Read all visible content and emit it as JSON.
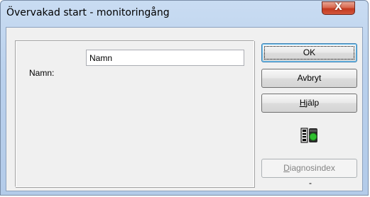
{
  "window": {
    "title": "Övervakad start - monitoringång",
    "close_label": "X"
  },
  "form": {
    "name_label": "Namn:",
    "name_value": "Namn"
  },
  "buttons": {
    "ok_label": "OK",
    "cancel_label": "Avbryt",
    "help_prefix": "H",
    "help_rest": "jälp",
    "diagnos_prefix": "D",
    "diagnos_rest": "iagnosindex"
  },
  "status": {
    "value": "-"
  },
  "icons": {
    "module_icon": "module-status-icon"
  },
  "colors": {
    "titlebar": "#b9d0ec",
    "close_button": "#c3391f",
    "panel": "#f0f0f0",
    "status_green": "#2fc02f"
  }
}
